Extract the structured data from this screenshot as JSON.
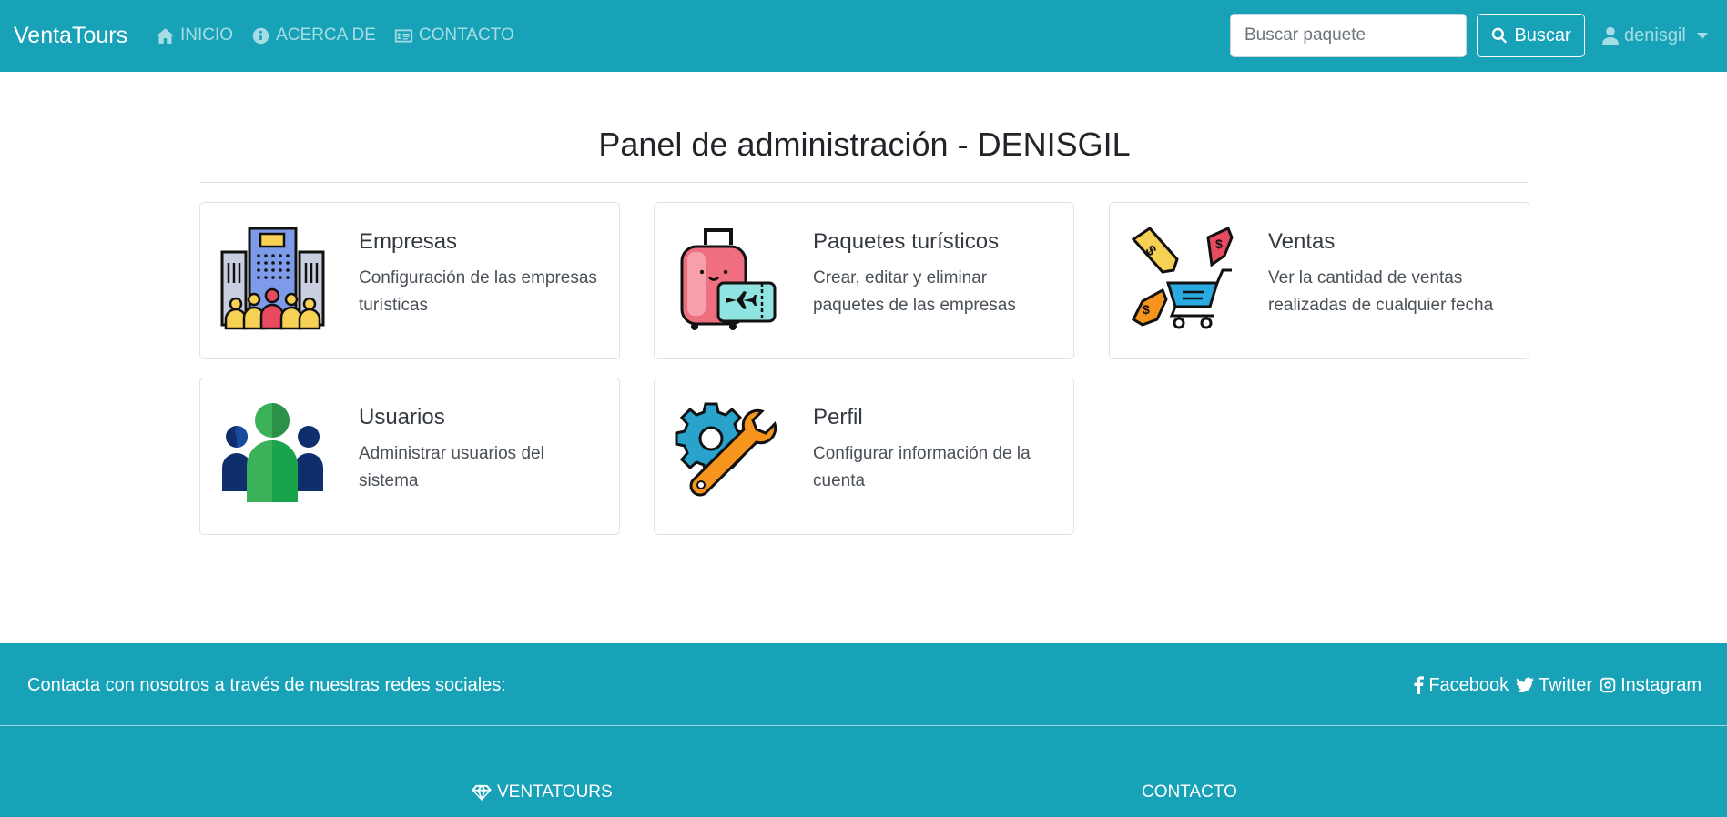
{
  "navbar": {
    "brand": "VentaTours",
    "links": [
      {
        "label": "INICIO",
        "icon": "home-icon"
      },
      {
        "label": "ACERCA DE",
        "icon": "info-circle-icon"
      },
      {
        "label": "CONTACTO",
        "icon": "id-card-icon"
      }
    ],
    "search": {
      "placeholder": "Buscar paquete",
      "value": "",
      "button_label": "Buscar",
      "button_icon": "search-icon"
    },
    "user": {
      "name": "denisgil",
      "icon": "user-icon"
    }
  },
  "main": {
    "title": "Panel de administración - DENISGIL",
    "cards": [
      {
        "title": "Empresas",
        "text": "Configuración de las empresas turísticas",
        "icon": "buildings-people-icon"
      },
      {
        "title": "Paquetes turísticos",
        "text": "Crear, editar y eliminar paquetes de las empresas",
        "icon": "suitcase-ticket-icon"
      },
      {
        "title": "Ventas",
        "text": "Ver la cantidad de ventas realizadas de cualquier fecha",
        "icon": "shopping-cart-tags-icon"
      },
      {
        "title": "Usuarios",
        "text": "Administrar usuarios del sistema",
        "icon": "users-group-icon"
      },
      {
        "title": "Perfil",
        "text": "Configurar información de la cuenta",
        "icon": "gear-wrench-icon"
      }
    ]
  },
  "footer": {
    "contact_text": "Contacta con nosotros a través de nuestras redes sociales:",
    "social": [
      {
        "label": "Facebook",
        "icon": "facebook-icon"
      },
      {
        "label": "Twitter",
        "icon": "twitter-icon"
      },
      {
        "label": "Instagram",
        "icon": "instagram-icon"
      }
    ],
    "headings": [
      {
        "label": "VENTATOURS",
        "icon": "gem-icon"
      },
      {
        "label": "CONTACTO"
      }
    ]
  },
  "colors": {
    "primary": "#17a2b8",
    "text": "#212529",
    "border": "#dfe2e6"
  }
}
